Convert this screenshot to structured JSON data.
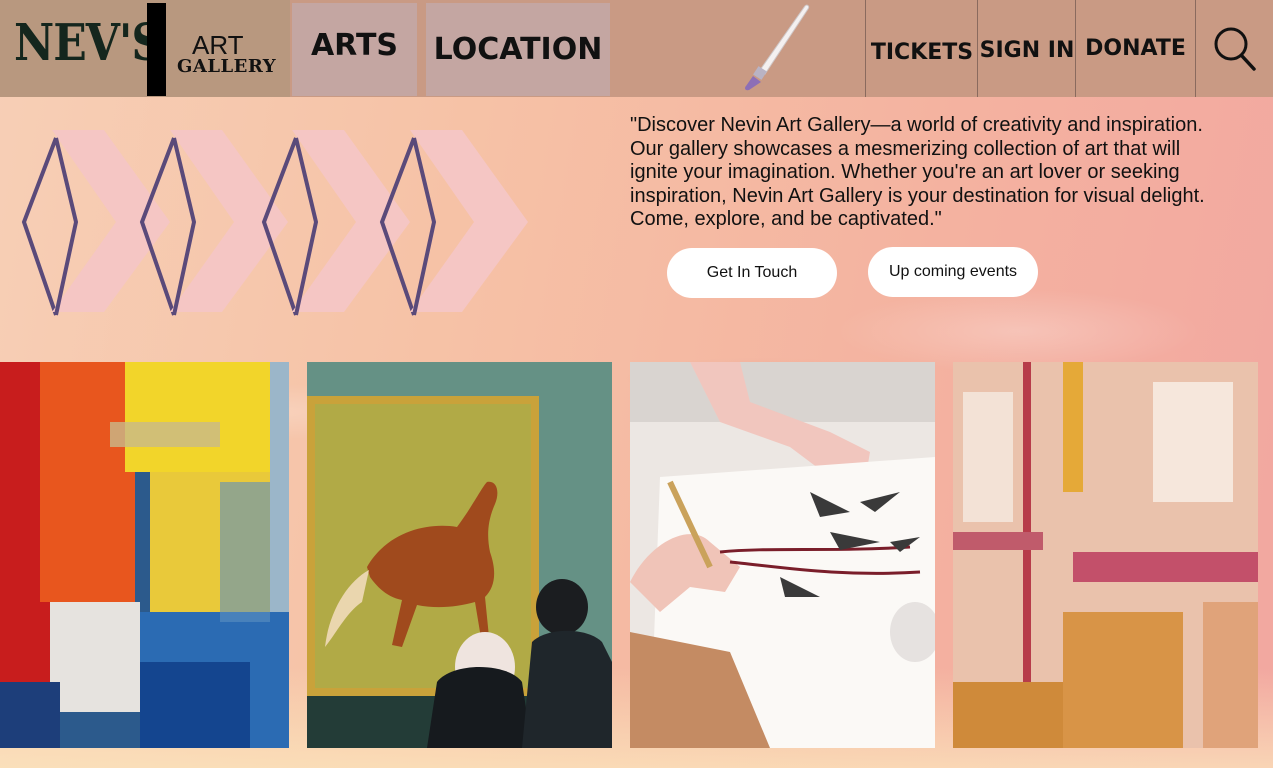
{
  "header": {
    "logo_name": "NEV'S",
    "logo_art": "ART",
    "logo_gallery": "GALLERY",
    "nav": {
      "arts": "ARTS",
      "location": "LOCATION",
      "tickets": "TICKETS",
      "sign_in": "SIGN IN",
      "donate": "DONATE"
    },
    "icons": [
      "paintbrush-icon",
      "search-icon"
    ]
  },
  "hero": {
    "tagline": "\"Discover Nevin Art Gallery—a world of creativity and inspiration. Our gallery showcases a mesmerizing collection of art that will ignite your imagination. Whether you're an art lover or seeking inspiration, Nevin Art Gallery is your destination for visual delight. Come, explore, and be captivated.\"",
    "buttons": {
      "get_in_touch": "Get In Touch",
      "upcoming_events": "Up coming events"
    }
  },
  "gallery": {
    "tiles": [
      "abstract-colorful-painting",
      "horse-painting-with-visitors",
      "ink-brush-painting",
      "pink-abstract-painting"
    ]
  },
  "colors": {
    "header_bg": "#c99a84",
    "logo_bg": "#b8987f",
    "nav_box_bg": "#c4a6a2",
    "chevron_fill": "#f5c6c4",
    "chevron_outline": "#5a4a7a"
  }
}
